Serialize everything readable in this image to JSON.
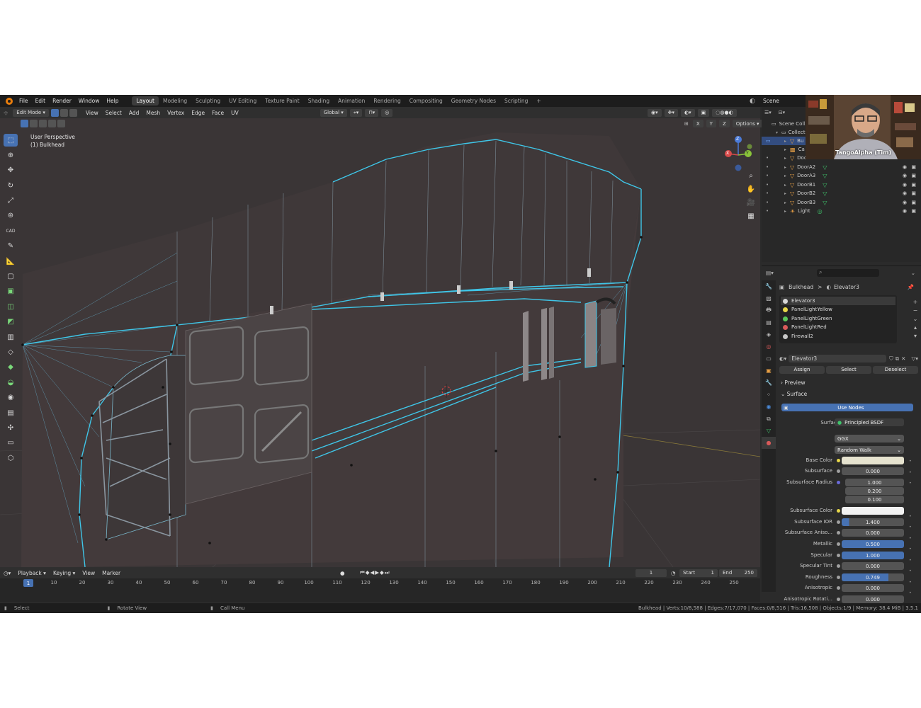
{
  "menu": {
    "items": [
      "File",
      "Edit",
      "Render",
      "Window",
      "Help"
    ],
    "workspaces": [
      "Layout",
      "Modeling",
      "Sculpting",
      "UV Editing",
      "Texture Paint",
      "Shading",
      "Animation",
      "Rendering",
      "Compositing",
      "Geometry Nodes",
      "Scripting"
    ],
    "add_tab": "+",
    "scene_label": "Scene"
  },
  "viewport_header": {
    "mode": "Edit Mode",
    "menus": [
      "View",
      "Select",
      "Add",
      "Mesh",
      "Vertex",
      "Edge",
      "Face",
      "UV"
    ],
    "orientation": "Global",
    "options": "Options",
    "axes": [
      "X",
      "Y",
      "Z"
    ]
  },
  "viewport": {
    "perspective": "User Perspective",
    "object": "(1) Bulkhead"
  },
  "gizmo": {
    "x": "X",
    "y": "Y",
    "z": "Z"
  },
  "timeline": {
    "menus": [
      "Playback",
      "Keying",
      "View",
      "Marker"
    ],
    "current_frame": "1",
    "start_label": "Start",
    "start": "1",
    "end_label": "End",
    "end": "250",
    "ticks": [
      "10",
      "20",
      "30",
      "40",
      "50",
      "60",
      "70",
      "80",
      "90",
      "100",
      "110",
      "120",
      "130",
      "140",
      "150",
      "160",
      "170",
      "180",
      "190",
      "200",
      "210",
      "220",
      "230",
      "240",
      "250"
    ],
    "cursor": "1"
  },
  "status": {
    "select": "Select",
    "rotate": "Rotate View",
    "call_menu": "Call Menu",
    "stats": "Bulkhead | Verts:10/8,588 | Edges:7/17,070 | Faces:0/8,516 | Tris:16,508 | Objects:1/9 | Memory: 38.4 MiB | 3.5.1"
  },
  "outliner": {
    "scene_collection": "Scene Coll",
    "collection": "Collect",
    "items": [
      {
        "name": "Bu"
      },
      {
        "name": "Ca"
      },
      {
        "name": "Door"
      },
      {
        "name": "DoorA2"
      },
      {
        "name": "DoorA3"
      },
      {
        "name": "DoorB1"
      },
      {
        "name": "DoorB2"
      },
      {
        "name": "DoorB3"
      },
      {
        "name": "Light"
      }
    ]
  },
  "webcam": {
    "caption": "TangoAlpha (Tim)"
  },
  "properties": {
    "breadcrumb_object": "Bulkhead",
    "breadcrumb_sep": ">",
    "breadcrumb_material": "Elevator3",
    "materials": [
      {
        "name": "Elevator3",
        "color": "#d8d8d8"
      },
      {
        "name": "PanelLightYellow",
        "color": "#e8d84a"
      },
      {
        "name": "PanelLightGreen",
        "color": "#5ac85a"
      },
      {
        "name": "PanelLightRed",
        "color": "#d85a5a"
      },
      {
        "name": "Firewall2",
        "color": "#c8c8c8"
      }
    ],
    "material_name": "Elevator3",
    "assign": "Assign",
    "select": "Select",
    "deselect": "Deselect",
    "preview": "Preview",
    "surface_section": "Surface",
    "use_nodes": "Use Nodes",
    "surface_label": "Surface",
    "surface_value": "Principled BSDF",
    "distribution": "GGX",
    "subsurface_method": "Random Walk",
    "fields": [
      {
        "label": "Base Color",
        "value": "",
        "kind": "color",
        "color": "#e6e3cf"
      },
      {
        "label": "Subsurface",
        "value": "0.000",
        "kind": "num"
      },
      {
        "label": "Subsurface Radius",
        "value": "1.000",
        "kind": "num"
      },
      {
        "label": "",
        "value": "0.200",
        "kind": "num"
      },
      {
        "label": "",
        "value": "0.100",
        "kind": "num"
      },
      {
        "label": "Subsurface Color",
        "value": "",
        "kind": "color",
        "color": "#f2f2f2"
      },
      {
        "label": "Subsurface IOR",
        "value": "1.400",
        "kind": "num"
      },
      {
        "label": "Subsurface Aniso...",
        "value": "0.000",
        "kind": "num"
      },
      {
        "label": "Metallic",
        "value": "0.500",
        "kind": "blue"
      },
      {
        "label": "Specular",
        "value": "1.000",
        "kind": "blue"
      },
      {
        "label": "Specular Tint",
        "value": "0.000",
        "kind": "num"
      },
      {
        "label": "Roughness",
        "value": "0.749",
        "kind": "blue"
      },
      {
        "label": "Anisotropic",
        "value": "0.000",
        "kind": "num"
      },
      {
        "label": "Anisotropic Rotati...",
        "value": "0.000",
        "kind": "num"
      }
    ]
  },
  "colors": {
    "accent": "#4772b3",
    "wire": "#3fc6e8",
    "mesh_face": "#4a4142"
  }
}
